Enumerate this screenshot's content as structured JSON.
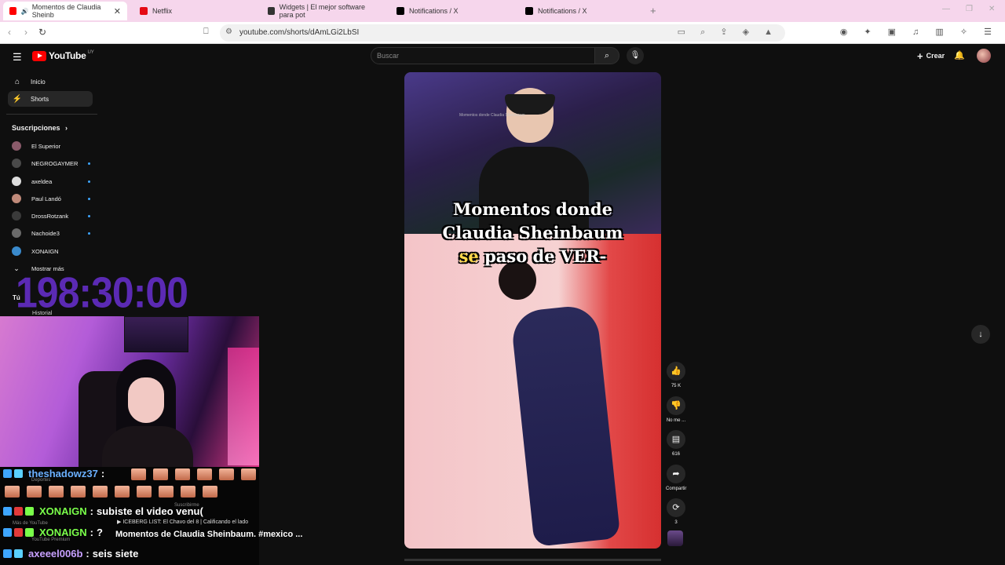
{
  "browser": {
    "tabs": [
      {
        "title": "Momentos de Claudia Sheinb",
        "active": true,
        "favicon_color": "#ff0000"
      },
      {
        "title": "Netflix",
        "active": false,
        "favicon_color": "#e50914"
      },
      {
        "title": "Widgets | El mejor software para pot",
        "active": false,
        "favicon_color": "#333333"
      },
      {
        "title": "Notifications / X",
        "active": false,
        "favicon_color": "#000000"
      },
      {
        "title": "Notifications / X",
        "active": false,
        "favicon_color": "#000000"
      }
    ],
    "url": "youtube.com/shorts/dAmLGi2LbSI"
  },
  "youtube": {
    "logo_text": "YouTube",
    "country_code": "UY",
    "search_placeholder": "Buscar",
    "create_label": "Crear"
  },
  "sidebar": {
    "items": [
      {
        "label": "Inicio",
        "icon": "home-icon",
        "active": false
      },
      {
        "label": "Shorts",
        "icon": "shorts-icon",
        "active": true
      }
    ],
    "subscriptions_label": "Suscripciones",
    "subscriptions": [
      {
        "name": "El Superior",
        "color": "#8a5a6a",
        "new": false
      },
      {
        "name": "NEGROGAYMER",
        "color": "#4a4a4a",
        "new": true
      },
      {
        "name": "axeldea",
        "color": "#dddddd",
        "new": true
      },
      {
        "name": "Paul Landó",
        "color": "#c08a7a",
        "new": true
      },
      {
        "name": "DrossRotzank",
        "color": "#3a3a3a",
        "new": true
      },
      {
        "name": "Nachoide3",
        "color": "#6a6a6a",
        "new": true
      },
      {
        "name": "XONAIGN",
        "color": "#3a8acc",
        "new": false
      }
    ],
    "show_more": "Mostrar más",
    "you_label": "Tú",
    "history_label": "Historial"
  },
  "overlay": {
    "timer": "198:30:00"
  },
  "chat": [
    {
      "user": "theshadowz37",
      "user_color": "#6ab0ff",
      "separator": ":",
      "message": ""
    },
    {
      "user": "XONAIGN",
      "user_color": "#7aff4a",
      "separator": ":",
      "message": "subiste el video venu("
    },
    {
      "user": "XONAIGN",
      "user_color": "#7aff4a",
      "separator": ":",
      "message": "?"
    },
    {
      "user": "axeeel006b",
      "user_color": "#c8a0ff",
      "separator": ":",
      "message": "seis siete"
    }
  ],
  "chat_ghost": {
    "deportes": "Deportes",
    "suscribirme": "Suscribirme",
    "mas_youtube": "Más de YouTube",
    "premium": "YouTube Premium"
  },
  "video": {
    "caption_line1": "Momentos donde",
    "caption_line2": "Claudia Sheinbaum",
    "caption_hl": "se",
    "caption_line3": "paso de VER-",
    "tiny_title": "Momentos donde Claudia Sheinbaum",
    "iceberg": "ICEBERG LIST: El Chavo del 8 | Calificando el lado",
    "title": "Momentos de Claudia Sheinbaum. #mexico ..."
  },
  "actions": {
    "likes": "75 K",
    "dislike": "No me ...",
    "comments": "616",
    "share": "Compartir",
    "remix": "3"
  }
}
